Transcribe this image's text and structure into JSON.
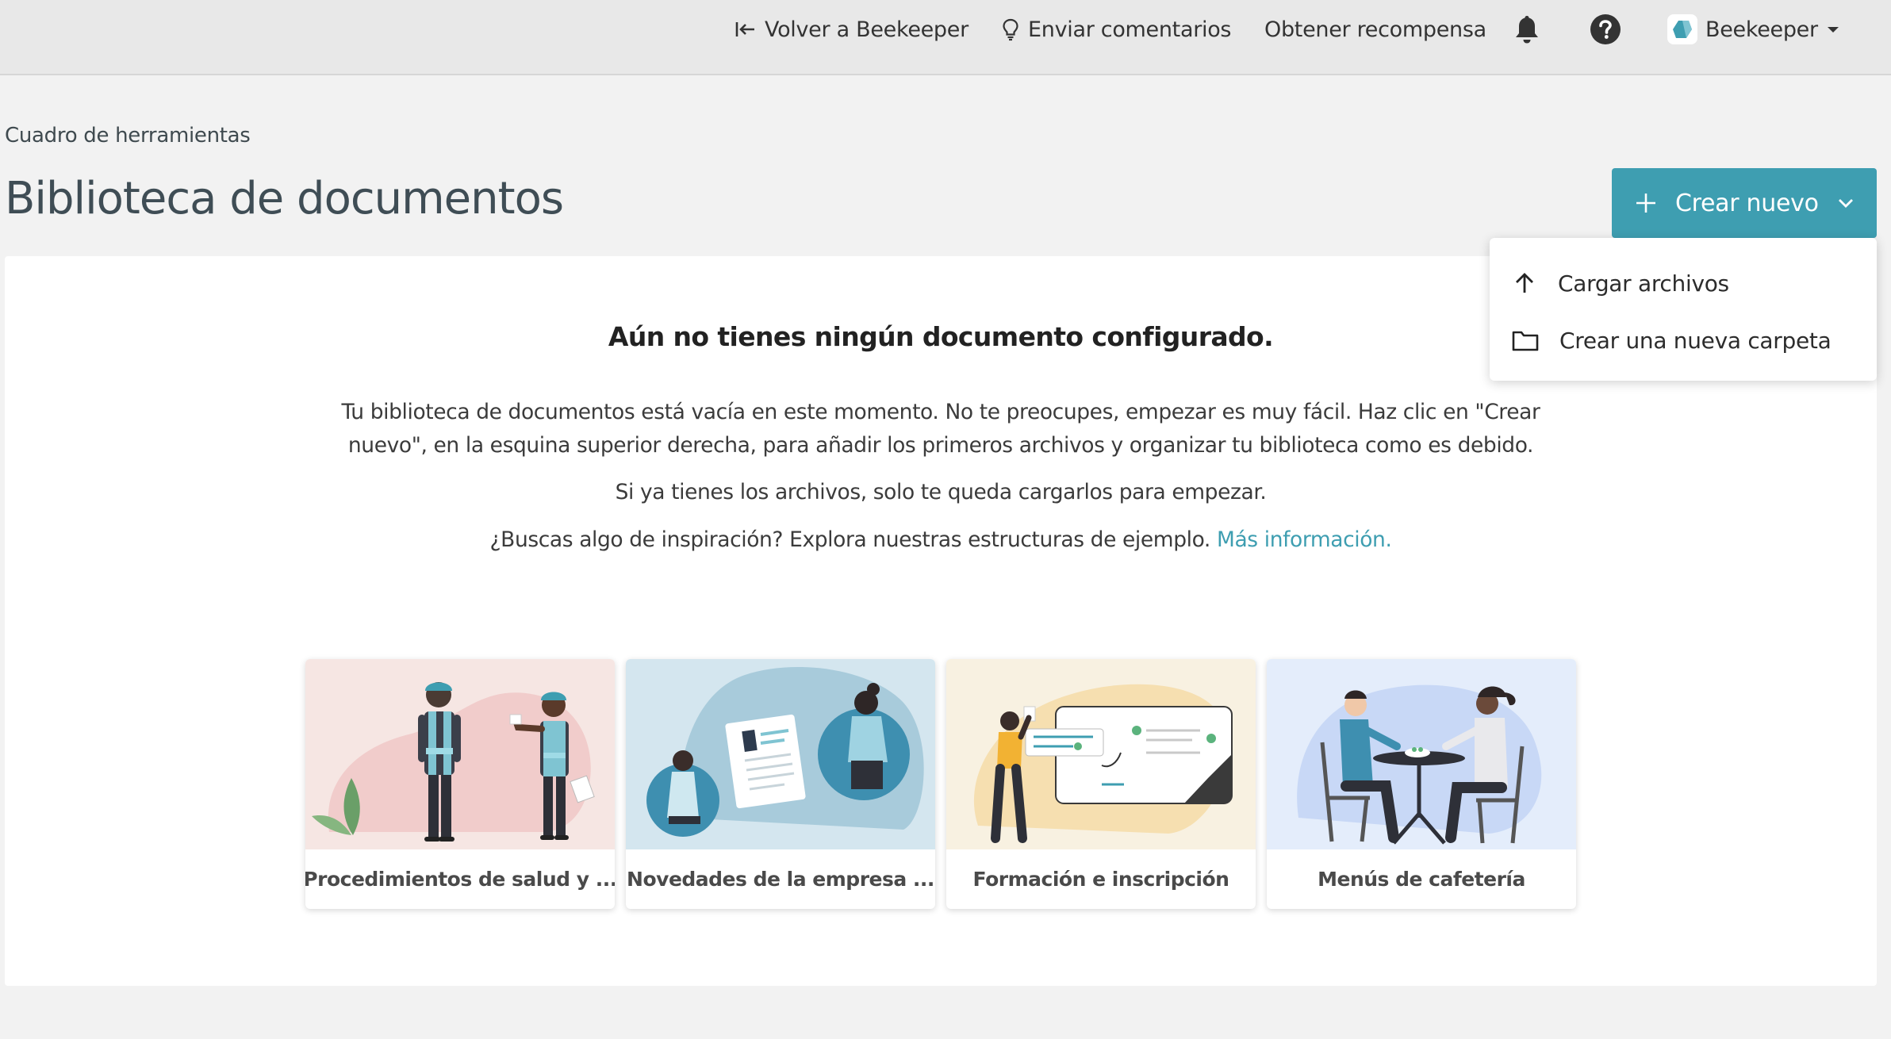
{
  "topbar": {
    "back_label": "Volver a Beekeeper",
    "feedback_label": "Enviar comentarios",
    "reward_label": "Obtener recompensa",
    "account_label": "Beekeeper"
  },
  "header": {
    "breadcrumb": "Cuadro de herramientas",
    "title": "Biblioteca de documentos",
    "create_label": "Crear nuevo"
  },
  "dropdown": {
    "items": [
      {
        "label": "Cargar archivos",
        "icon": "arrow-up-icon"
      },
      {
        "label": "Crear una nueva carpeta",
        "icon": "folder-icon"
      }
    ]
  },
  "empty_state": {
    "title": "Aún no tienes ningún documento configurado.",
    "description": "Tu biblioteca de documentos está vacía en este momento. No te preocupes, empezar es muy fácil. Haz clic en \"Crear nuevo\", en la esquina superior derecha, para añadir los primeros archivos y organizar tu biblioteca como es debido.",
    "existing_files": "Si ya tienes los archivos, solo te queda cargarlos para empezar.",
    "inspiration": "¿Buscas algo de inspiración? Explora nuestras estructuras de ejemplo.",
    "more_link": "Más información."
  },
  "templates": [
    {
      "label": "Procedimientos de salud y ...",
      "bg": "#f6e6e3"
    },
    {
      "label": "Novedades de la empresa ...",
      "bg": "#d4e6ef"
    },
    {
      "label": "Formación e inscripción",
      "bg": "#f8f1e1"
    },
    {
      "label": "Menús de cafetería",
      "bg": "#e4edfb"
    }
  ],
  "colors": {
    "accent": "#3e9eb1",
    "topbar_bg": "#e8e8e8",
    "page_bg": "#f2f2f2"
  }
}
